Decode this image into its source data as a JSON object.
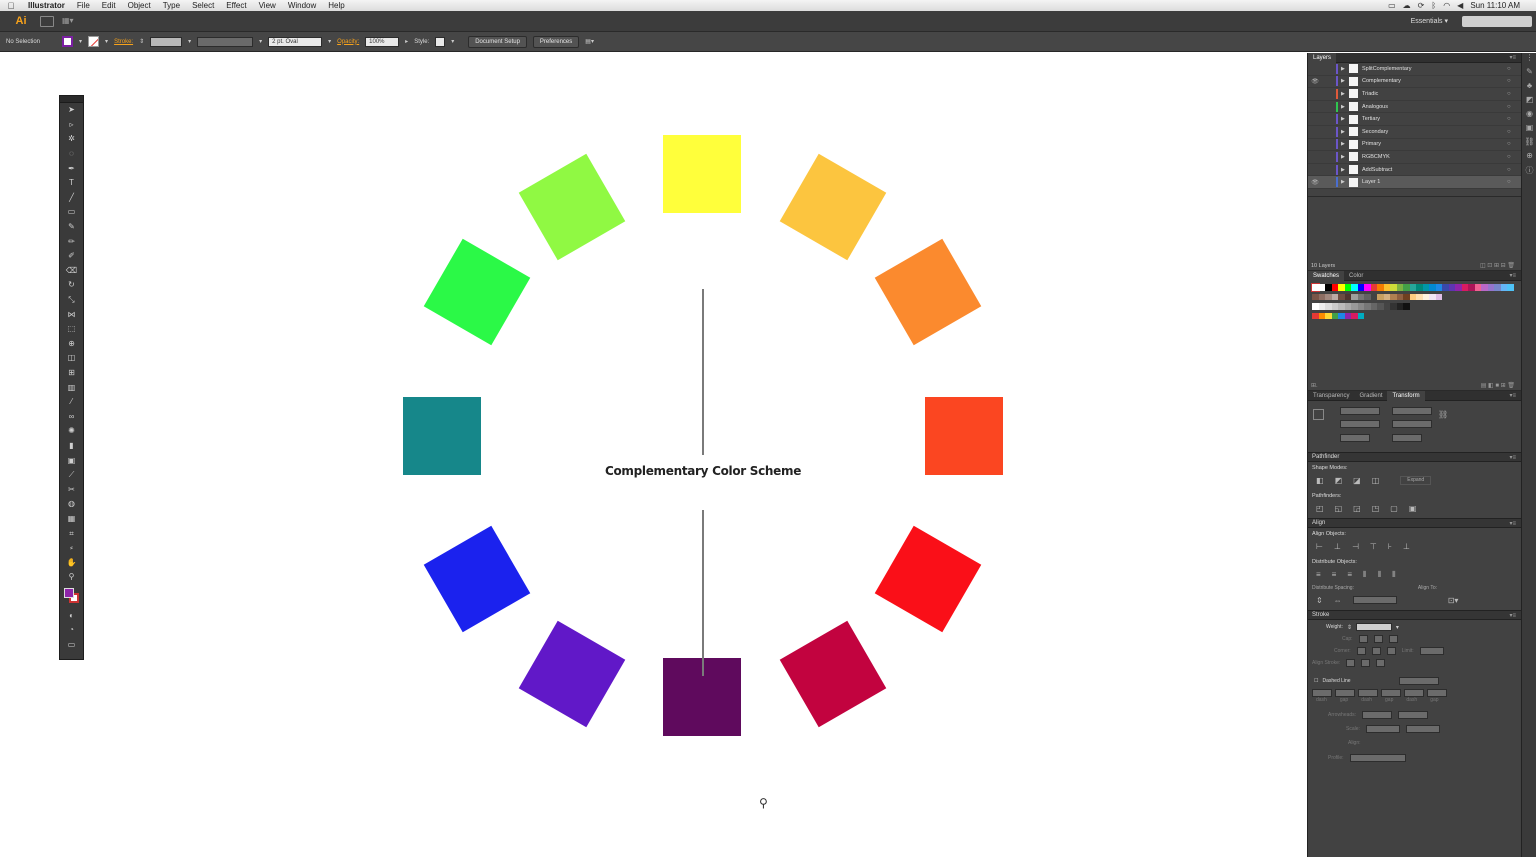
{
  "menubar": {
    "apple": "",
    "app_name": "Illustrator",
    "items": [
      "File",
      "Edit",
      "Object",
      "Type",
      "Select",
      "Effect",
      "View",
      "Window",
      "Help"
    ],
    "clock": "Sun 11:10 AM"
  },
  "appbar": {
    "logo": "Ai",
    "workspace": "Essentials"
  },
  "controlbar": {
    "selection": "No Selection",
    "stroke_label": "Stroke:",
    "brush_value": "2 pt. Oval",
    "opacity_label": "Opacity:",
    "opacity_value": "100%",
    "style_label": "Style:",
    "document_setup": "Document Setup",
    "preferences": "Preferences"
  },
  "canvas": {
    "title": "Complementary Color Scheme",
    "squares": [
      {
        "name": "yellow",
        "color": "#ffff3b"
      },
      {
        "name": "yellow-orange",
        "color": "#fcc53f"
      },
      {
        "name": "orange",
        "color": "#fb8a2e"
      },
      {
        "name": "red-orange",
        "color": "#fb4621"
      },
      {
        "name": "red",
        "color": "#fa0f18"
      },
      {
        "name": "red-violet",
        "color": "#c2033f"
      },
      {
        "name": "violet",
        "color": "#5f0a5d"
      },
      {
        "name": "blue-violet",
        "color": "#6118c8"
      },
      {
        "name": "blue",
        "color": "#1b22ee"
      },
      {
        "name": "teal",
        "color": "#16878a"
      },
      {
        "name": "green",
        "color": "#2bf947"
      },
      {
        "name": "yellow-green",
        "color": "#90f943"
      }
    ]
  },
  "layers_panel": {
    "tab": "Layers",
    "layers": [
      {
        "name": "SplitComplementary",
        "color": "#6b56c8",
        "visible": false
      },
      {
        "name": "Complementary",
        "color": "#6b56c8",
        "visible": true
      },
      {
        "name": "Triadic",
        "color": "#e05a3b",
        "visible": false
      },
      {
        "name": "Analogous",
        "color": "#2fc64f",
        "visible": false
      },
      {
        "name": "Tertiary",
        "color": "#6b56c8",
        "visible": false
      },
      {
        "name": "Secondary",
        "color": "#6b56c8",
        "visible": false
      },
      {
        "name": "Primary",
        "color": "#6b56c8",
        "visible": false
      },
      {
        "name": "RGBCMYK",
        "color": "#6b56c8",
        "visible": false
      },
      {
        "name": "AddSubtract",
        "color": "#6b56c8",
        "visible": false
      },
      {
        "name": "Layer 1",
        "color": "#4a6ed0",
        "visible": true
      }
    ],
    "count": "10 Layers"
  },
  "swatches_panel": {
    "tabs": [
      "Swatches",
      "Color"
    ],
    "row1": [
      "#ffffff",
      "#000000",
      "#ff0000",
      "#ffff00",
      "#00ff00",
      "#00ffff",
      "#0000ff",
      "#ff00ff",
      "#e53935",
      "#f57c00",
      "#fbc02d",
      "#cddc39",
      "#7cb342",
      "#43a047",
      "#26a69a",
      "#00897b",
      "#0097a7",
      "#0288d1",
      "#1e88e5",
      "#3949ab",
      "#5e35b1",
      "#8e24aa",
      "#d81b60",
      "#ad1457",
      "#f06292",
      "#ba68c8",
      "#9575cd",
      "#7986cb",
      "#64b5f6",
      "#4fc3f7"
    ],
    "row2": [
      "#795548",
      "#8d6e63",
      "#a1887f",
      "#bcaaa4",
      "#6d4c41",
      "#4e342e",
      "#9e9e9e",
      "#757575",
      "#616161",
      "#424242",
      "#c8a060",
      "#d4b080",
      "#b08050",
      "#906040",
      "#704020",
      "#ffcc80",
      "#ffe0b2",
      "#fff3e0",
      "#f3e5f5",
      "#e1bee7"
    ],
    "grays": [
      "#ffffff",
      "#eeeeee",
      "#dddddd",
      "#cccccc",
      "#bbbbbb",
      "#aaaaaa",
      "#999999",
      "#888888",
      "#777777",
      "#666666",
      "#555555",
      "#444444",
      "#333333",
      "#222222",
      "#111111"
    ],
    "brights": [
      "#e53935",
      "#fb8c00",
      "#fdd835",
      "#43a047",
      "#1e88e5",
      "#8e24aa",
      "#d81b60",
      "#00acc1"
    ]
  },
  "lower_panels": {
    "tabs": [
      "Transparency",
      "Gradient",
      "Transform"
    ],
    "pathfinder": "Pathfinder",
    "shape_modes": "Shape Modes:",
    "expand": "Expand",
    "pathfinders": "Pathfinders:",
    "align": "Align",
    "align_objects": "Align Objects:",
    "distribute_objects": "Distribute Objects:",
    "distribute_spacing": "Distribute Spacing:",
    "align_to": "Align To:",
    "stroke": "Stroke",
    "weight": "Weight:",
    "cap": "Cap:",
    "corner": "Corner:",
    "limit": "Limit:",
    "align_stroke": "Align Stroke:",
    "dashed_line": "Dashed Line",
    "dash_labels": [
      "dash",
      "gap",
      "dash",
      "gap",
      "dash",
      "gap"
    ],
    "arrowheads": "Arrowheads:",
    "scale": "Scale:",
    "align_label": "Align:",
    "profile": "Profile:"
  }
}
